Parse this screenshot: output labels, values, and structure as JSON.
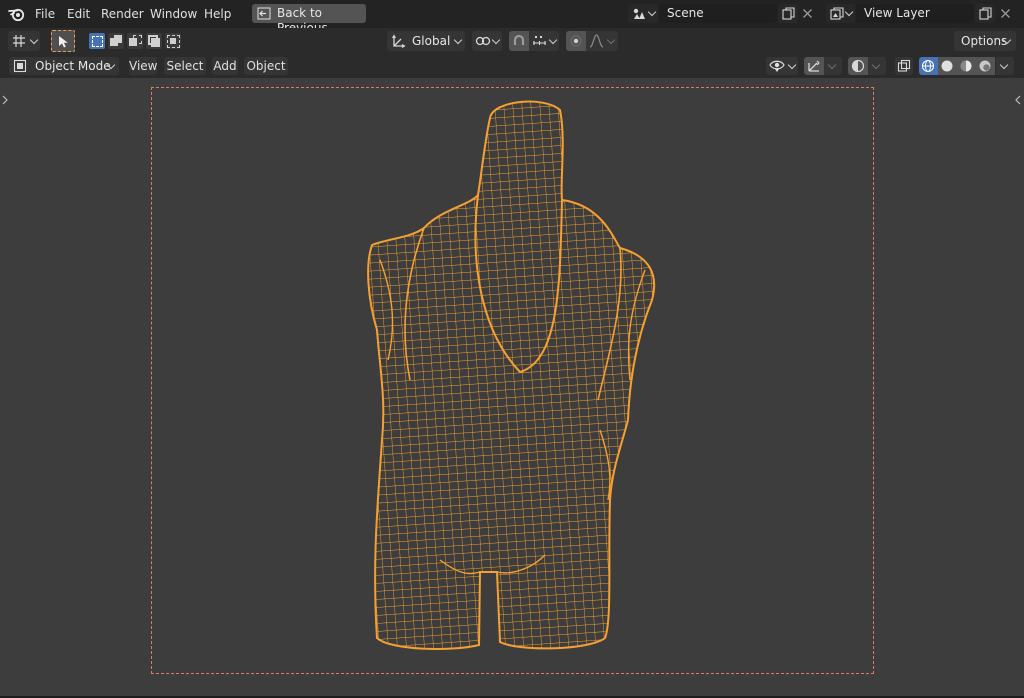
{
  "topbar": {
    "menu": [
      "File",
      "Edit",
      "Render",
      "Window",
      "Help"
    ],
    "back_button": "Back to Previous",
    "scene": "Scene",
    "view_layer": "View Layer"
  },
  "tool_header": {
    "transform_orientation": "Global",
    "options": "Options"
  },
  "viewport_header": {
    "mode": "Object Mode",
    "menus": [
      "View",
      "Select",
      "Add",
      "Object"
    ]
  },
  "colors": {
    "wireframe": "#f5a033",
    "viewport_bg": "#3d3d3d",
    "camera_frame": "#e07a62",
    "active_blue": "#4772b3"
  },
  "icons": [
    "blender-logo-icon",
    "back-icon",
    "scene-icon",
    "copy-icon",
    "close-icon",
    "view-layer-icon",
    "editor-type-icon",
    "select-tool-icon",
    "transform-orientation-icon",
    "pivot-icon",
    "snap-icon",
    "proportional-edit-icon",
    "falloff-icon",
    "object-mode-icon",
    "visibility-icon",
    "gizmo-icon",
    "overlay-icon",
    "xray-icon",
    "wireframe-shading-icon",
    "solid-shading-icon",
    "material-shading-icon",
    "rendered-shading-icon"
  ]
}
